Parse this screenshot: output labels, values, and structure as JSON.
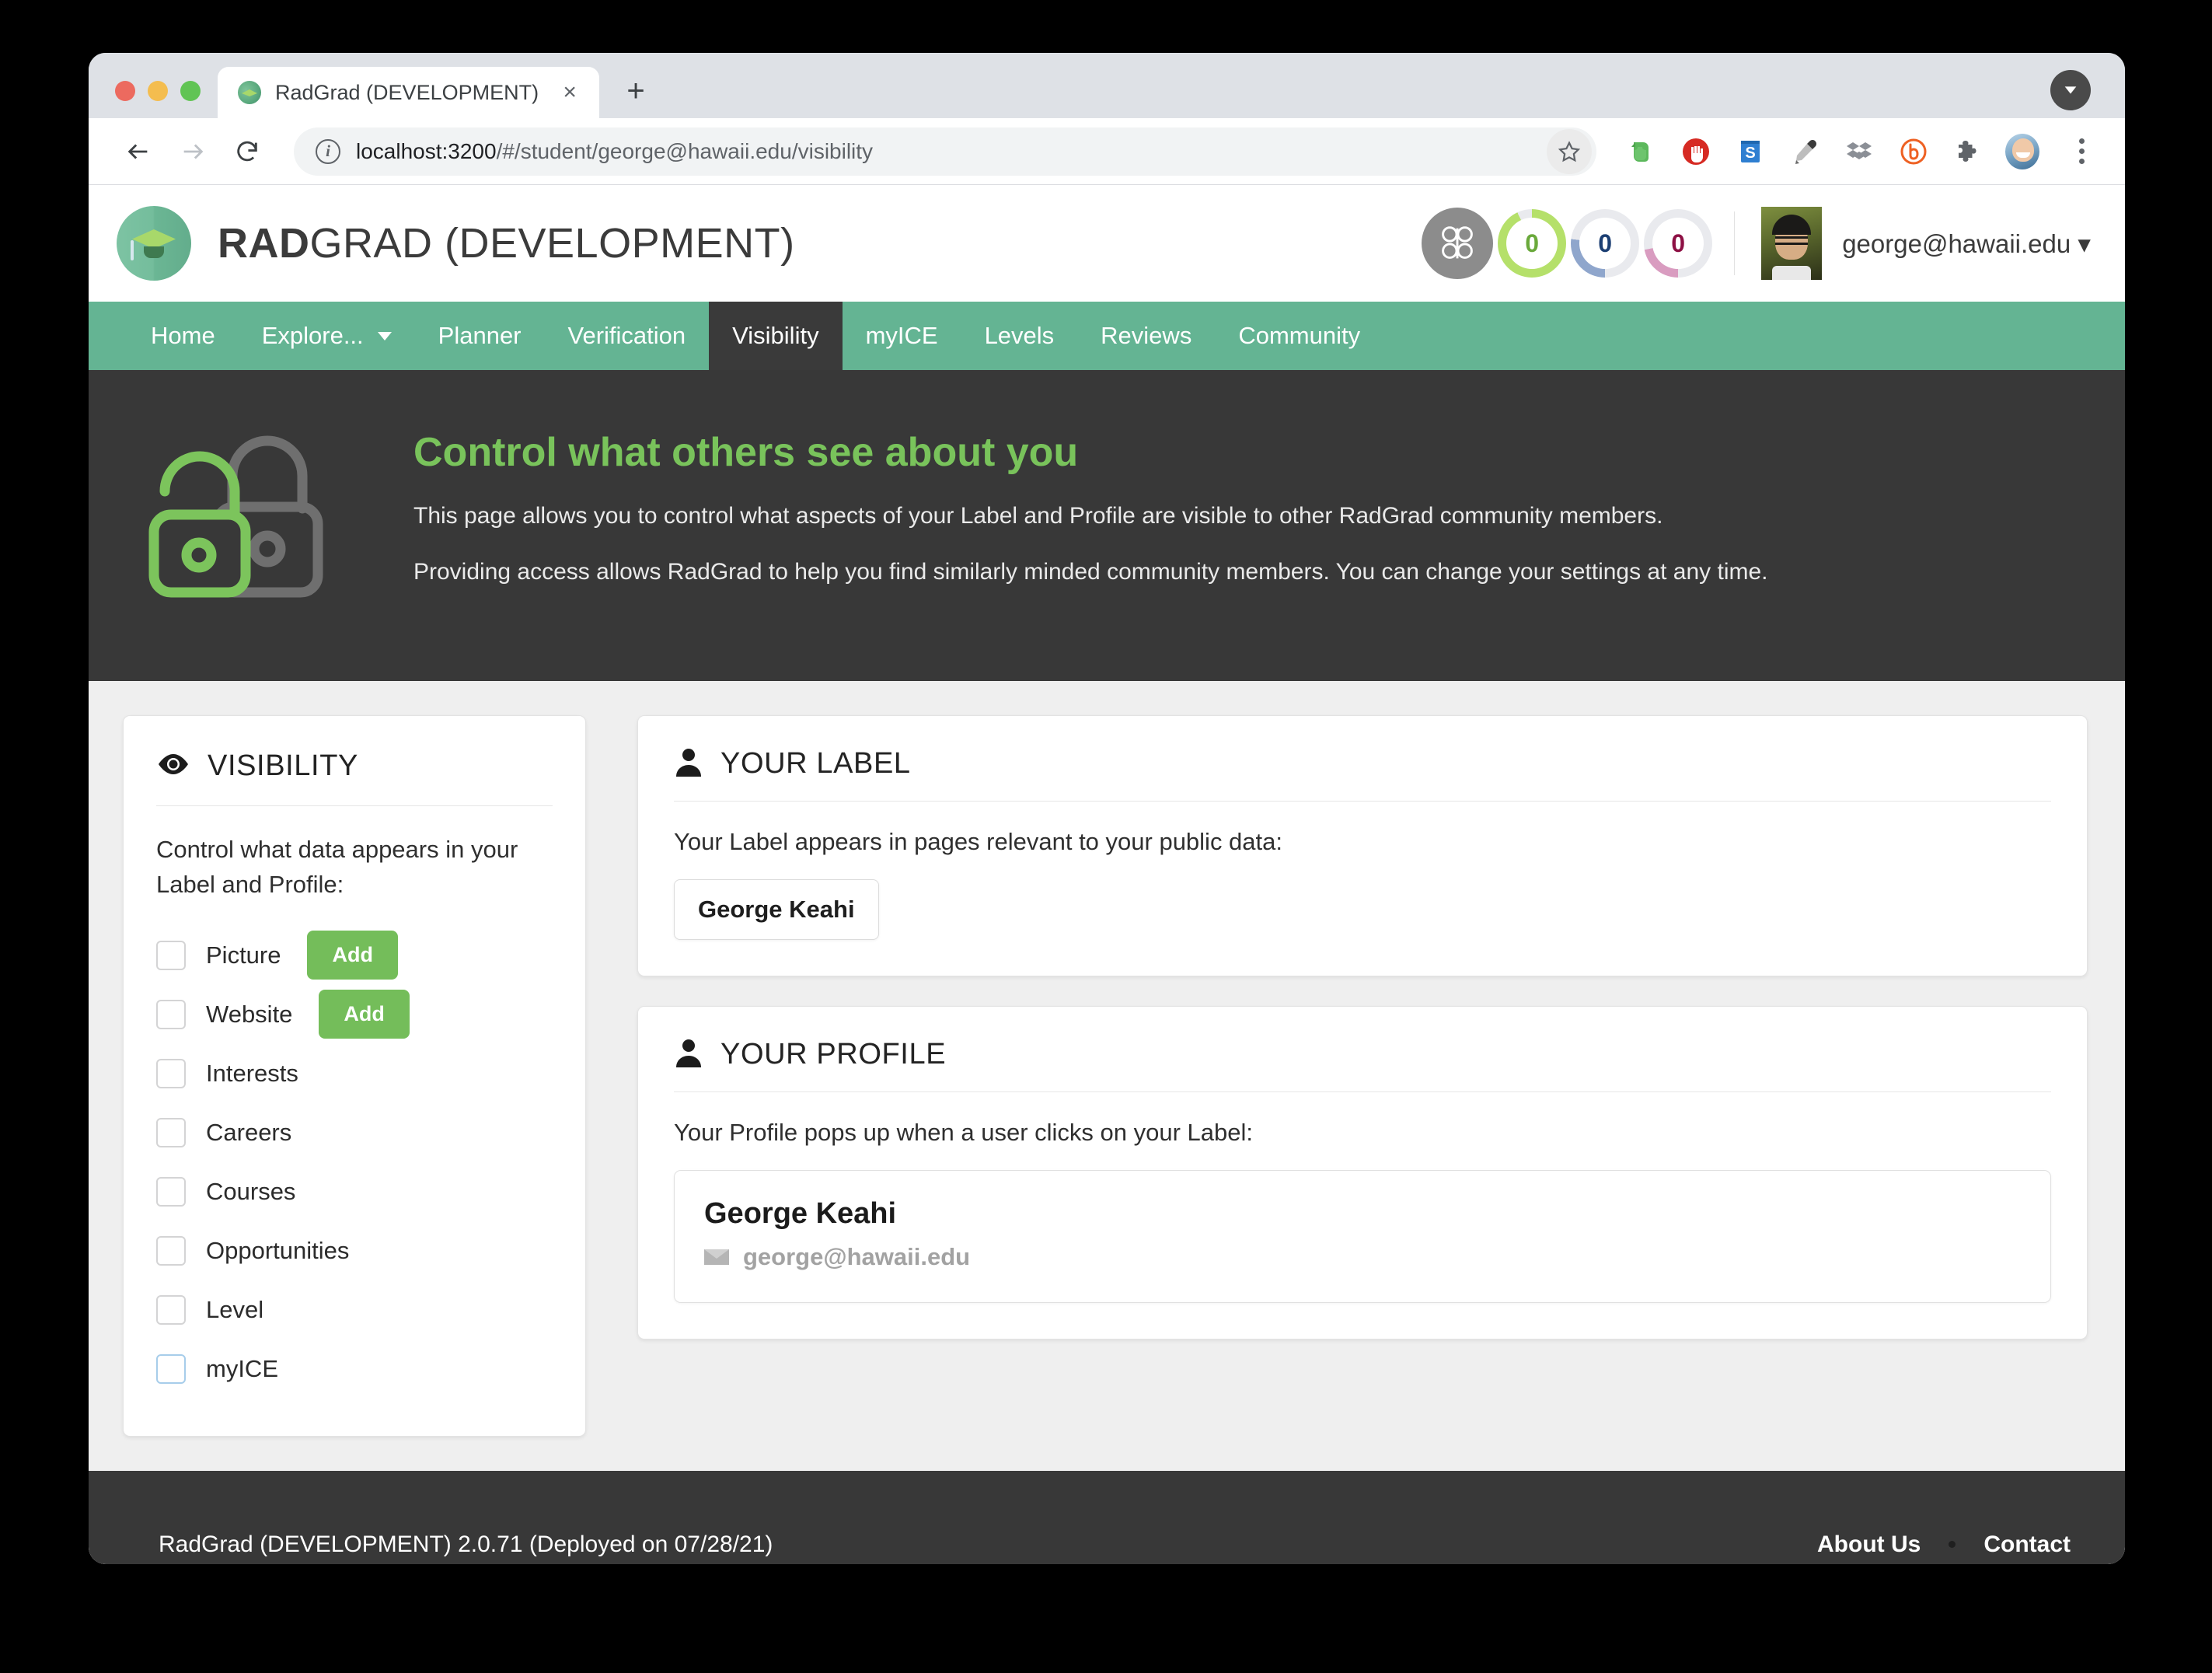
{
  "browser": {
    "tab": {
      "title": "RadGrad (DEVELOPMENT)",
      "favicon": "radgrad-favicon",
      "close": "×"
    },
    "new_tab_label": "+",
    "address": {
      "url_host": "localhost:3200",
      "url_path": "/#/student/george@hawaii.edu/visibility",
      "info_icon": "info-icon"
    },
    "extensions": [
      {
        "name": "evernote-extension-icon"
      },
      {
        "name": "adblock-extension-icon"
      },
      {
        "name": "skitch-extension-icon",
        "letter": "S"
      },
      {
        "name": "eyedropper-extension-icon"
      },
      {
        "name": "dropbox-extension-icon"
      },
      {
        "name": "bitly-extension-icon"
      },
      {
        "name": "puzzle-extensions-icon"
      }
    ]
  },
  "header": {
    "logo_bold": "RAD",
    "logo_rest": "GRAD (DEVELOPMENT)",
    "ice": {
      "clover_icon": "ice-clover-icon",
      "rings": [
        {
          "name": "innovation-ring",
          "value": "0",
          "track": "#e9eaee",
          "arc": "#b5e06a",
          "text": "#6aa93b",
          "pct": 93
        },
        {
          "name": "competency-ring",
          "value": "0",
          "track": "#e9eaee",
          "arc": "#8fa6cc",
          "text": "#1c3f73",
          "pct": 27
        },
        {
          "name": "experience-ring",
          "value": "0",
          "track": "#e9eaee",
          "arc": "#d99cc0",
          "text": "#8d1044",
          "pct": 22
        }
      ]
    },
    "user_email": "george@hawaii.edu",
    "user_caret": "▾"
  },
  "nav": {
    "items": [
      {
        "label": "Home",
        "active": false,
        "caret": false
      },
      {
        "label": "Explore...",
        "active": false,
        "caret": true
      },
      {
        "label": "Planner",
        "active": false,
        "caret": false
      },
      {
        "label": "Verification",
        "active": false,
        "caret": false
      },
      {
        "label": "Visibility",
        "active": true,
        "caret": false
      },
      {
        "label": "myICE",
        "active": false,
        "caret": false
      },
      {
        "label": "Levels",
        "active": false,
        "caret": false
      },
      {
        "label": "Reviews",
        "active": false,
        "caret": false
      },
      {
        "label": "Community",
        "active": false,
        "caret": false
      }
    ]
  },
  "hero": {
    "icon": "double-padlock-icon",
    "title": "Control what others see about you",
    "paragraph1": "This page allows you to control what aspects of your Label and Profile are visible to other RadGrad community members.",
    "paragraph2": "Providing access allows RadGrad to help you find similarly minded community members. You can change your settings at any time."
  },
  "visibility_card": {
    "icon": "eye-icon",
    "title": "VISIBILITY",
    "description": "Control what data appears in your Label and Profile:",
    "options": [
      {
        "label": "Picture",
        "checked": false,
        "focus": false,
        "action": "Add"
      },
      {
        "label": "Website",
        "checked": false,
        "focus": false,
        "action": "Add"
      },
      {
        "label": "Interests",
        "checked": false,
        "focus": false,
        "action": null
      },
      {
        "label": "Careers",
        "checked": false,
        "focus": false,
        "action": null
      },
      {
        "label": "Courses",
        "checked": false,
        "focus": false,
        "action": null
      },
      {
        "label": "Opportunities",
        "checked": false,
        "focus": false,
        "action": null
      },
      {
        "label": "Level",
        "checked": false,
        "focus": false,
        "action": null
      },
      {
        "label": "myICE",
        "checked": false,
        "focus": true,
        "action": null
      }
    ]
  },
  "label_card": {
    "icon": "person-icon",
    "title": "YOUR LABEL",
    "description": "Your Label appears in pages relevant to your public data:",
    "chip": "George Keahi"
  },
  "profile_card": {
    "icon": "person-icon",
    "title": "YOUR PROFILE",
    "description": "Your Profile pops up when a user clicks on your Label:",
    "name": "George Keahi",
    "email": "george@hawaii.edu",
    "email_icon": "envelope-icon"
  },
  "footer": {
    "version_text": "RadGrad (DEVELOPMENT) 2.0.71 (Deployed on 07/28/21)",
    "links": [
      "About Us",
      "Contact"
    ],
    "separator": "•"
  },
  "colors": {
    "nav_green": "#64b493",
    "dark": "#383838",
    "accent_green": "#74bd5a",
    "title_green": "#79c35b"
  }
}
